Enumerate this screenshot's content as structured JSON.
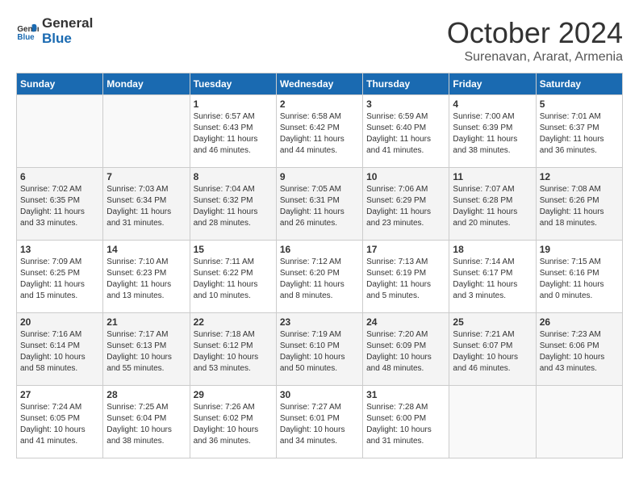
{
  "header": {
    "logo_general": "General",
    "logo_blue": "Blue",
    "month": "October 2024",
    "location": "Surenavan, Ararat, Armenia"
  },
  "weekdays": [
    "Sunday",
    "Monday",
    "Tuesday",
    "Wednesday",
    "Thursday",
    "Friday",
    "Saturday"
  ],
  "weeks": [
    [
      {
        "day": "",
        "info": ""
      },
      {
        "day": "",
        "info": ""
      },
      {
        "day": "1",
        "sunrise": "Sunrise: 6:57 AM",
        "sunset": "Sunset: 6:43 PM",
        "daylight": "Daylight: 11 hours and 46 minutes."
      },
      {
        "day": "2",
        "sunrise": "Sunrise: 6:58 AM",
        "sunset": "Sunset: 6:42 PM",
        "daylight": "Daylight: 11 hours and 44 minutes."
      },
      {
        "day": "3",
        "sunrise": "Sunrise: 6:59 AM",
        "sunset": "Sunset: 6:40 PM",
        "daylight": "Daylight: 11 hours and 41 minutes."
      },
      {
        "day": "4",
        "sunrise": "Sunrise: 7:00 AM",
        "sunset": "Sunset: 6:39 PM",
        "daylight": "Daylight: 11 hours and 38 minutes."
      },
      {
        "day": "5",
        "sunrise": "Sunrise: 7:01 AM",
        "sunset": "Sunset: 6:37 PM",
        "daylight": "Daylight: 11 hours and 36 minutes."
      }
    ],
    [
      {
        "day": "6",
        "sunrise": "Sunrise: 7:02 AM",
        "sunset": "Sunset: 6:35 PM",
        "daylight": "Daylight: 11 hours and 33 minutes."
      },
      {
        "day": "7",
        "sunrise": "Sunrise: 7:03 AM",
        "sunset": "Sunset: 6:34 PM",
        "daylight": "Daylight: 11 hours and 31 minutes."
      },
      {
        "day": "8",
        "sunrise": "Sunrise: 7:04 AM",
        "sunset": "Sunset: 6:32 PM",
        "daylight": "Daylight: 11 hours and 28 minutes."
      },
      {
        "day": "9",
        "sunrise": "Sunrise: 7:05 AM",
        "sunset": "Sunset: 6:31 PM",
        "daylight": "Daylight: 11 hours and 26 minutes."
      },
      {
        "day": "10",
        "sunrise": "Sunrise: 7:06 AM",
        "sunset": "Sunset: 6:29 PM",
        "daylight": "Daylight: 11 hours and 23 minutes."
      },
      {
        "day": "11",
        "sunrise": "Sunrise: 7:07 AM",
        "sunset": "Sunset: 6:28 PM",
        "daylight": "Daylight: 11 hours and 20 minutes."
      },
      {
        "day": "12",
        "sunrise": "Sunrise: 7:08 AM",
        "sunset": "Sunset: 6:26 PM",
        "daylight": "Daylight: 11 hours and 18 minutes."
      }
    ],
    [
      {
        "day": "13",
        "sunrise": "Sunrise: 7:09 AM",
        "sunset": "Sunset: 6:25 PM",
        "daylight": "Daylight: 11 hours and 15 minutes."
      },
      {
        "day": "14",
        "sunrise": "Sunrise: 7:10 AM",
        "sunset": "Sunset: 6:23 PM",
        "daylight": "Daylight: 11 hours and 13 minutes."
      },
      {
        "day": "15",
        "sunrise": "Sunrise: 7:11 AM",
        "sunset": "Sunset: 6:22 PM",
        "daylight": "Daylight: 11 hours and 10 minutes."
      },
      {
        "day": "16",
        "sunrise": "Sunrise: 7:12 AM",
        "sunset": "Sunset: 6:20 PM",
        "daylight": "Daylight: 11 hours and 8 minutes."
      },
      {
        "day": "17",
        "sunrise": "Sunrise: 7:13 AM",
        "sunset": "Sunset: 6:19 PM",
        "daylight": "Daylight: 11 hours and 5 minutes."
      },
      {
        "day": "18",
        "sunrise": "Sunrise: 7:14 AM",
        "sunset": "Sunset: 6:17 PM",
        "daylight": "Daylight: 11 hours and 3 minutes."
      },
      {
        "day": "19",
        "sunrise": "Sunrise: 7:15 AM",
        "sunset": "Sunset: 6:16 PM",
        "daylight": "Daylight: 11 hours and 0 minutes."
      }
    ],
    [
      {
        "day": "20",
        "sunrise": "Sunrise: 7:16 AM",
        "sunset": "Sunset: 6:14 PM",
        "daylight": "Daylight: 10 hours and 58 minutes."
      },
      {
        "day": "21",
        "sunrise": "Sunrise: 7:17 AM",
        "sunset": "Sunset: 6:13 PM",
        "daylight": "Daylight: 10 hours and 55 minutes."
      },
      {
        "day": "22",
        "sunrise": "Sunrise: 7:18 AM",
        "sunset": "Sunset: 6:12 PM",
        "daylight": "Daylight: 10 hours and 53 minutes."
      },
      {
        "day": "23",
        "sunrise": "Sunrise: 7:19 AM",
        "sunset": "Sunset: 6:10 PM",
        "daylight": "Daylight: 10 hours and 50 minutes."
      },
      {
        "day": "24",
        "sunrise": "Sunrise: 7:20 AM",
        "sunset": "Sunset: 6:09 PM",
        "daylight": "Daylight: 10 hours and 48 minutes."
      },
      {
        "day": "25",
        "sunrise": "Sunrise: 7:21 AM",
        "sunset": "Sunset: 6:07 PM",
        "daylight": "Daylight: 10 hours and 46 minutes."
      },
      {
        "day": "26",
        "sunrise": "Sunrise: 7:23 AM",
        "sunset": "Sunset: 6:06 PM",
        "daylight": "Daylight: 10 hours and 43 minutes."
      }
    ],
    [
      {
        "day": "27",
        "sunrise": "Sunrise: 7:24 AM",
        "sunset": "Sunset: 6:05 PM",
        "daylight": "Daylight: 10 hours and 41 minutes."
      },
      {
        "day": "28",
        "sunrise": "Sunrise: 7:25 AM",
        "sunset": "Sunset: 6:04 PM",
        "daylight": "Daylight: 10 hours and 38 minutes."
      },
      {
        "day": "29",
        "sunrise": "Sunrise: 7:26 AM",
        "sunset": "Sunset: 6:02 PM",
        "daylight": "Daylight: 10 hours and 36 minutes."
      },
      {
        "day": "30",
        "sunrise": "Sunrise: 7:27 AM",
        "sunset": "Sunset: 6:01 PM",
        "daylight": "Daylight: 10 hours and 34 minutes."
      },
      {
        "day": "31",
        "sunrise": "Sunrise: 7:28 AM",
        "sunset": "Sunset: 6:00 PM",
        "daylight": "Daylight: 10 hours and 31 minutes."
      },
      {
        "day": "",
        "info": ""
      },
      {
        "day": "",
        "info": ""
      }
    ]
  ]
}
